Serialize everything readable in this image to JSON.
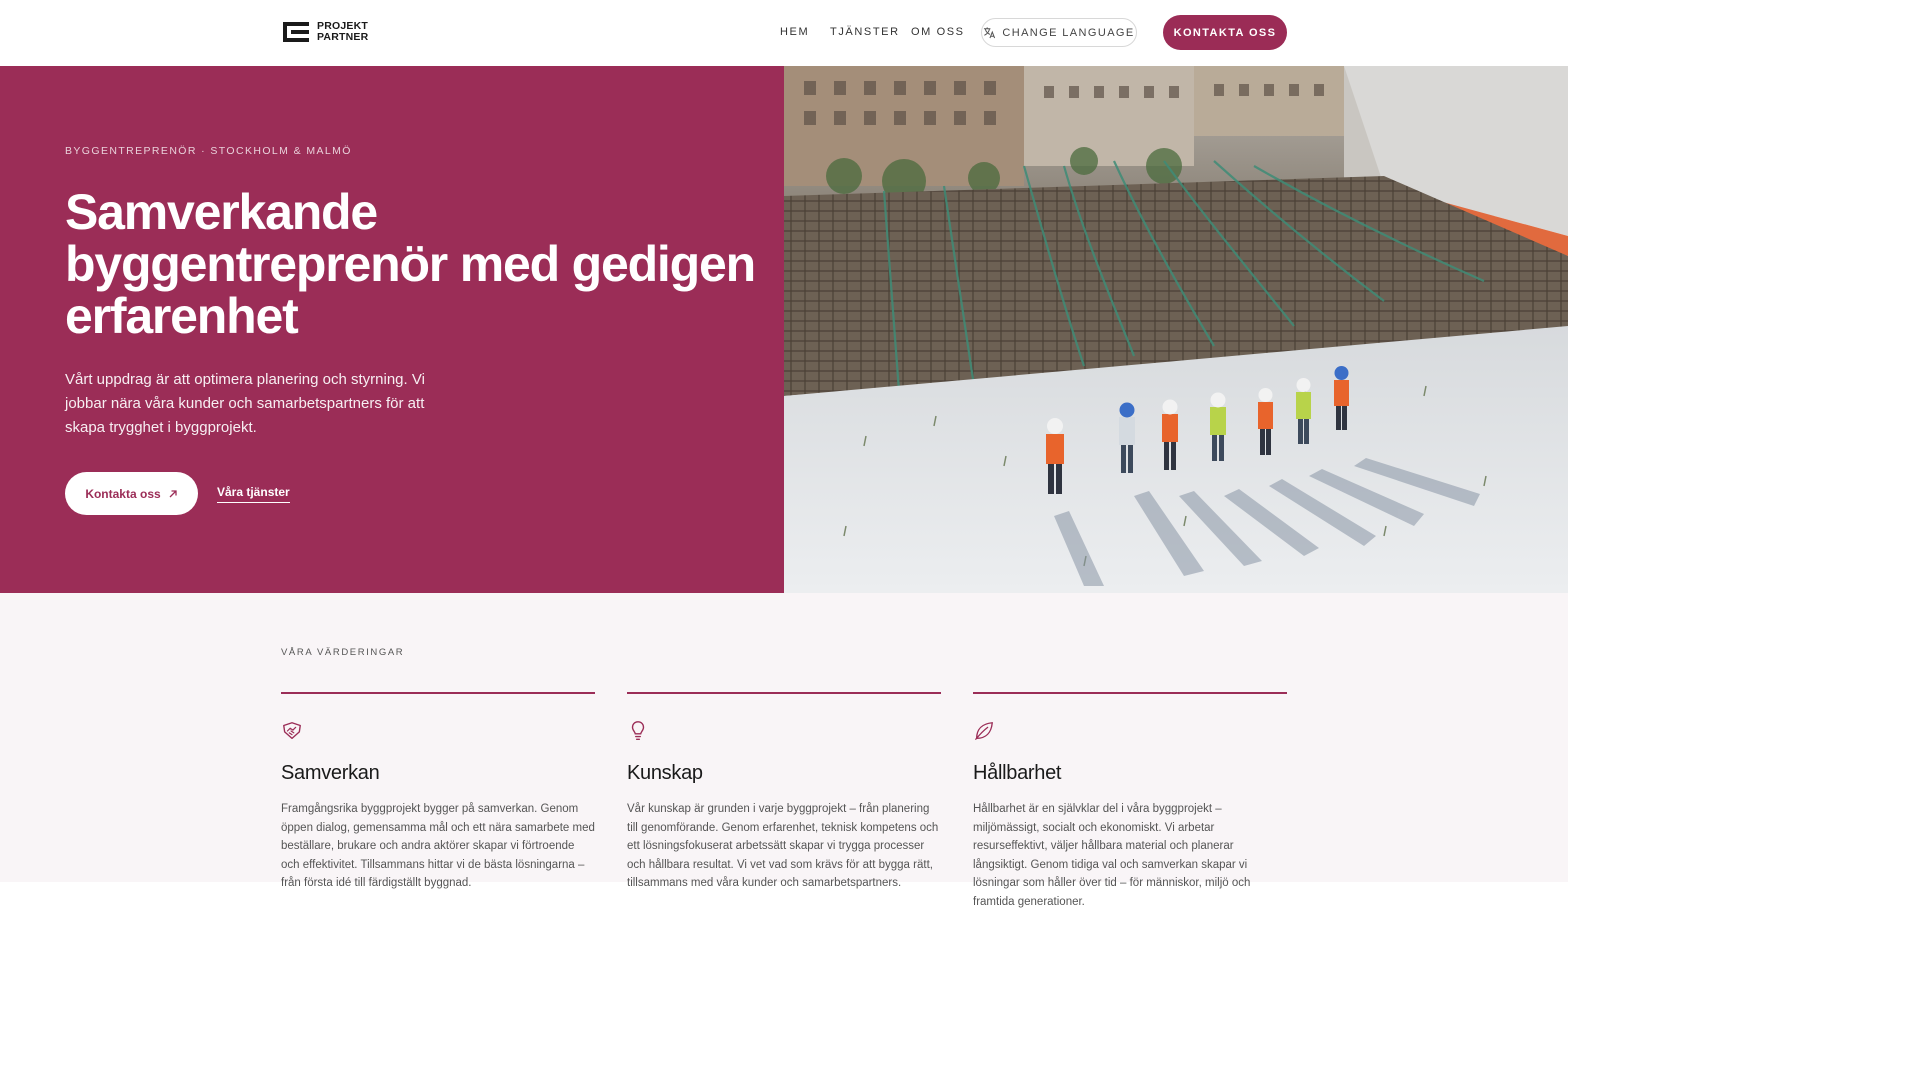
{
  "header": {
    "logo_line1": "PROJEKT",
    "logo_line2": "PARTNER",
    "nav": [
      "HEM",
      "TJÄNSTER",
      "OM OSS"
    ],
    "language_label": "CHANGE LANGUAGE",
    "contact_label": "KONTAKTA OSS"
  },
  "hero": {
    "eyebrow": "BYGGENTREPRENÖR · STOCKHOLM & MALMÖ",
    "title": "Samverkande byggentreprenör med gedigen erfarenhet",
    "text": "Vårt uppdrag är att optimera planering och styrning. Vi jobbar nära våra kunder och samarbetspartners för att skapa trygghet i byggprojekt.",
    "cta_label": "Kontakta oss",
    "link_label": "Våra tjänster",
    "image_icon": "construction-site-photo"
  },
  "values": {
    "eyebrow": "VÅRA VÄRDERINGAR",
    "items": [
      {
        "icon": "handshake-icon",
        "title": "Samverkan",
        "text": "Framgångsrika byggprojekt bygger på samverkan. Genom öppen dialog, gemensamma mål och ett nära samarbete med beställare, brukare och andra aktörer skapar vi förtroende och effektivitet. Tillsammans hittar vi de bästa lösningarna – från första idé till färdigställt byggnad."
      },
      {
        "icon": "lightbulb-icon",
        "title": "Kunskap",
        "text": "Vår kunskap är grunden i varje byggprojekt – från planering till genomförande. Genom erfarenhet, teknisk kompetens och ett lösningsfokuserat arbetssätt skapar vi trygga processer och hållbara resultat. Vi vet vad som krävs för att bygga rätt, tillsammans med våra kunder och samarbetspartners."
      },
      {
        "icon": "leaf-icon",
        "title": "Hållbarhet",
        "text": "Hållbarhet är en självklar del i våra byggprojekt – miljömässigt, socialt och ekonomiskt. Vi arbetar resurseffektivt, väljer hållbara material och planerar långsiktigt. Genom tidiga val och samverkan skapar vi lösningar som håller över tid – för människor, miljö och framtida generationer."
      }
    ]
  },
  "colors": {
    "brand": "#9b2d57",
    "values_bg": "#f9f5f7"
  }
}
